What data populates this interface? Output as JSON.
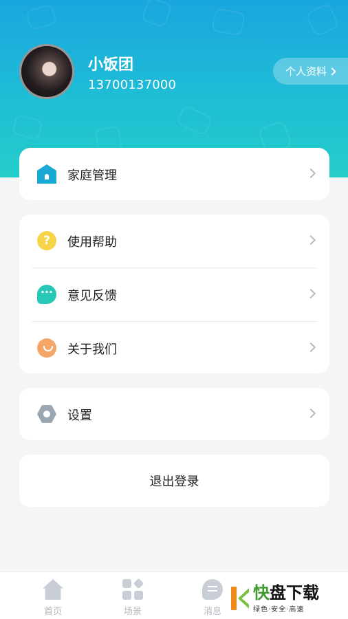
{
  "profile": {
    "name": "小饭团",
    "phone": "13700137000",
    "edit_button_label": "个人资料"
  },
  "menu_group_1": [
    {
      "label": "家庭管理",
      "icon": "house-icon"
    }
  ],
  "menu_group_2": [
    {
      "label": "使用帮助",
      "icon": "question-icon",
      "icon_text": "?"
    },
    {
      "label": "意见反馈",
      "icon": "chat-bubble-icon",
      "icon_text": "···"
    },
    {
      "label": "关于我们",
      "icon": "smile-icon"
    }
  ],
  "menu_group_3": [
    {
      "label": "设置",
      "icon": "hexagon-settings-icon"
    }
  ],
  "logout_label": "退出登录",
  "tabbar": {
    "tabs": [
      {
        "label": "首页",
        "icon": "home-icon"
      },
      {
        "label": "场景",
        "icon": "grid-icon"
      },
      {
        "label": "消息",
        "icon": "message-icon"
      }
    ]
  },
  "watermark": {
    "title_1": "快",
    "title_2": "盘下载",
    "subtitle": "绿色·安全·高速"
  },
  "colors": {
    "header_gradient_top": "#1aa6de",
    "header_gradient_bottom": "#24cdc9",
    "background": "#f4f5f7",
    "help_icon": "#f5d44a",
    "feedback_icon": "#27c9b6",
    "about_icon": "#f4a568",
    "settings_icon": "#9aa6b2",
    "tab_inactive": "#c9ced6"
  }
}
